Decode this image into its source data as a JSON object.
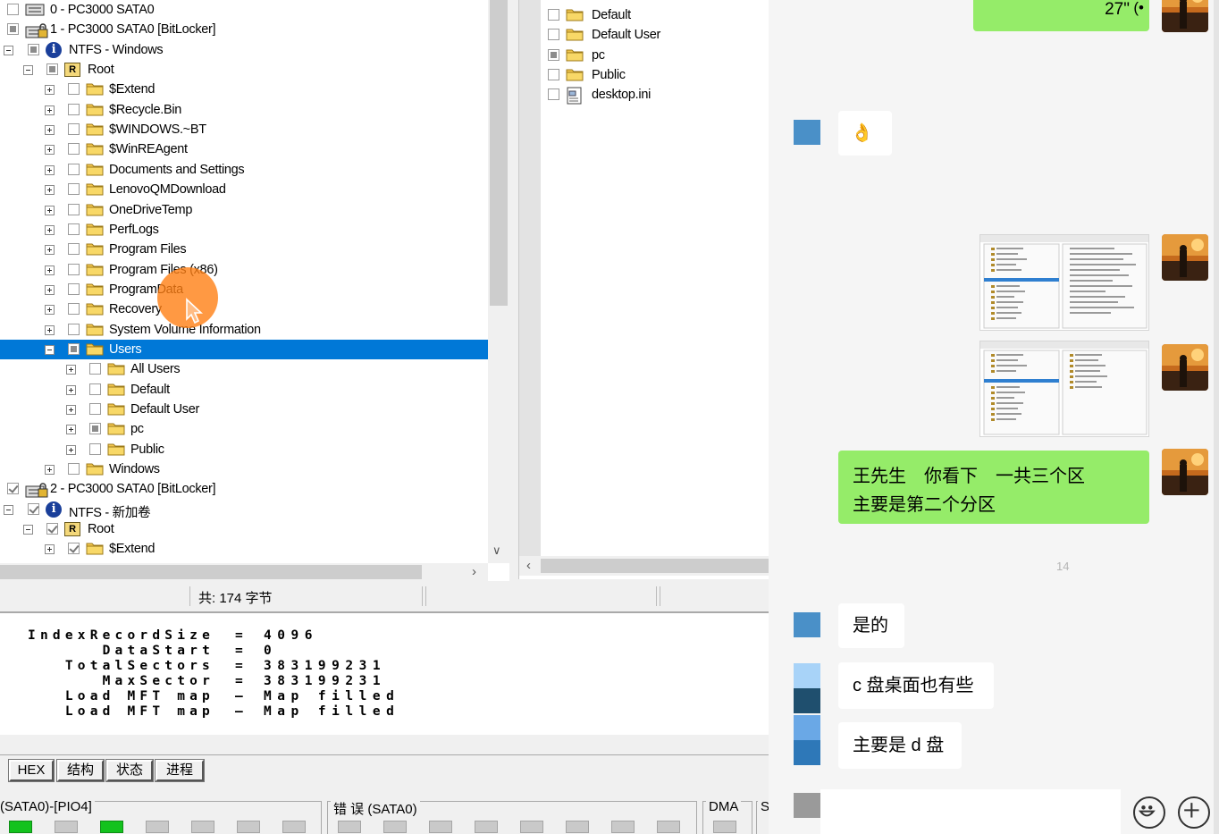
{
  "tree": {
    "rows": [
      {
        "indent": 0,
        "expander": "none",
        "check": "none",
        "icon": "disk",
        "label": "0 - PC3000 SATA0"
      },
      {
        "indent": 0,
        "expander": "none",
        "check": "partial",
        "icon": "disk-locked",
        "label": "1 - PC3000 SATA0 [BitLocker]"
      },
      {
        "indent": 0,
        "expander": "minus",
        "check": "partial",
        "icon": "info",
        "label": "NTFS - Windows"
      },
      {
        "indent": 1,
        "expander": "minus",
        "check": "partial",
        "icon": "root",
        "label": "Root"
      },
      {
        "indent": 2,
        "expander": "plus",
        "check": "none",
        "icon": "folder",
        "label": "$Extend"
      },
      {
        "indent": 2,
        "expander": "plus",
        "check": "none",
        "icon": "folder",
        "label": "$Recycle.Bin"
      },
      {
        "indent": 2,
        "expander": "plus",
        "check": "none",
        "icon": "folder",
        "label": "$WINDOWS.~BT"
      },
      {
        "indent": 2,
        "expander": "plus",
        "check": "none",
        "icon": "folder",
        "label": "$WinREAgent"
      },
      {
        "indent": 2,
        "expander": "plus",
        "check": "none",
        "icon": "folder",
        "label": "Documents and Settings"
      },
      {
        "indent": 2,
        "expander": "plus",
        "check": "none",
        "icon": "folder",
        "label": "LenovoQMDownload"
      },
      {
        "indent": 2,
        "expander": "plus",
        "check": "none",
        "icon": "folder",
        "label": "OneDriveTemp"
      },
      {
        "indent": 2,
        "expander": "plus",
        "check": "none",
        "icon": "folder",
        "label": "PerfLogs"
      },
      {
        "indent": 2,
        "expander": "plus",
        "check": "none",
        "icon": "folder",
        "label": "Program Files"
      },
      {
        "indent": 2,
        "expander": "plus",
        "check": "none",
        "icon": "folder",
        "label": "Program Files (x86)"
      },
      {
        "indent": 2,
        "expander": "plus",
        "check": "none",
        "icon": "folder",
        "label": "ProgramData"
      },
      {
        "indent": 2,
        "expander": "plus",
        "check": "none",
        "icon": "folder",
        "label": "Recovery"
      },
      {
        "indent": 2,
        "expander": "plus",
        "check": "none",
        "icon": "folder",
        "label": "System Volume Information"
      },
      {
        "indent": 2,
        "expander": "minus",
        "check": "partial",
        "icon": "folder",
        "label": "Users",
        "selected": true
      },
      {
        "indent": 3,
        "expander": "plus",
        "check": "none",
        "icon": "folder",
        "label": "All Users"
      },
      {
        "indent": 3,
        "expander": "plus",
        "check": "none",
        "icon": "folder",
        "label": "Default"
      },
      {
        "indent": 3,
        "expander": "plus",
        "check": "none",
        "icon": "folder",
        "label": "Default User"
      },
      {
        "indent": 3,
        "expander": "plus",
        "check": "partial",
        "icon": "folder",
        "label": "pc"
      },
      {
        "indent": 3,
        "expander": "plus",
        "check": "none",
        "icon": "folder",
        "label": "Public"
      },
      {
        "indent": 2,
        "expander": "plus",
        "check": "none",
        "icon": "folder",
        "label": "Windows"
      },
      {
        "indent": 0,
        "expander": "none",
        "check": "checked",
        "icon": "disk-locked",
        "label": "2 - PC3000 SATA0 [BitLocker]"
      },
      {
        "indent": 0,
        "expander": "minus",
        "check": "checked",
        "icon": "info",
        "label": "NTFS - 新加卷"
      },
      {
        "indent": 1,
        "expander": "minus",
        "check": "checked",
        "icon": "root",
        "label": "Root"
      },
      {
        "indent": 2,
        "expander": "plus",
        "check": "checked",
        "icon": "folder",
        "label": "$Extend"
      }
    ]
  },
  "files": {
    "rows": [
      {
        "check": "none",
        "icon": "folder",
        "label": "Default"
      },
      {
        "check": "none",
        "icon": "folder",
        "label": "Default User"
      },
      {
        "check": "partial",
        "icon": "folder",
        "label": "pc"
      },
      {
        "check": "none",
        "icon": "folder",
        "label": "Public"
      },
      {
        "check": "none",
        "icon": "file",
        "label": "desktop.ini"
      }
    ]
  },
  "status": {
    "total": "共: 174 字节"
  },
  "hex": {
    "lines": [
      {
        "key": "IndexRecordSize",
        "op": "=",
        "val": "4096"
      },
      {
        "key": "DataStart",
        "op": "=",
        "val": "0"
      },
      {
        "key": "TotalSectors",
        "op": "=",
        "val": "383199231"
      },
      {
        "key": "MaxSector",
        "op": "=",
        "val": "383199231"
      },
      {
        "key": "Load MFT map",
        "op": "–",
        "val": "Map filled"
      },
      {
        "key": "Load MFT map",
        "op": "–",
        "val": "Map filled"
      }
    ]
  },
  "tabs": [
    "HEX",
    "结构",
    "状态",
    "进程"
  ],
  "leds": {
    "group1_title": "(SATA0)-[PIO4]",
    "group1_states": [
      true,
      false,
      true,
      false,
      false,
      false,
      false
    ],
    "group2_title": "错 误 (SATA0)",
    "group2_states": [
      false,
      false,
      false,
      false,
      false,
      false,
      false,
      false
    ],
    "group3_title": "DMA",
    "group4_title": "S"
  },
  "chat": {
    "voice_duration": "27\"",
    "messages": [
      {
        "text": "👌",
        "color": "#4a90c8"
      },
      {
        "text": "王先生　你看下　一共三个区"
      },
      {
        "text": "主要是第二个分区"
      },
      {
        "text": "是的",
        "color": "#4a90c8"
      },
      {
        "text": "c 盘桌面也有些",
        "color": "#1f4f6e"
      },
      {
        "text": "主要是 d 盘",
        "color": "#2e78b8"
      }
    ],
    "timestamp": "14"
  }
}
